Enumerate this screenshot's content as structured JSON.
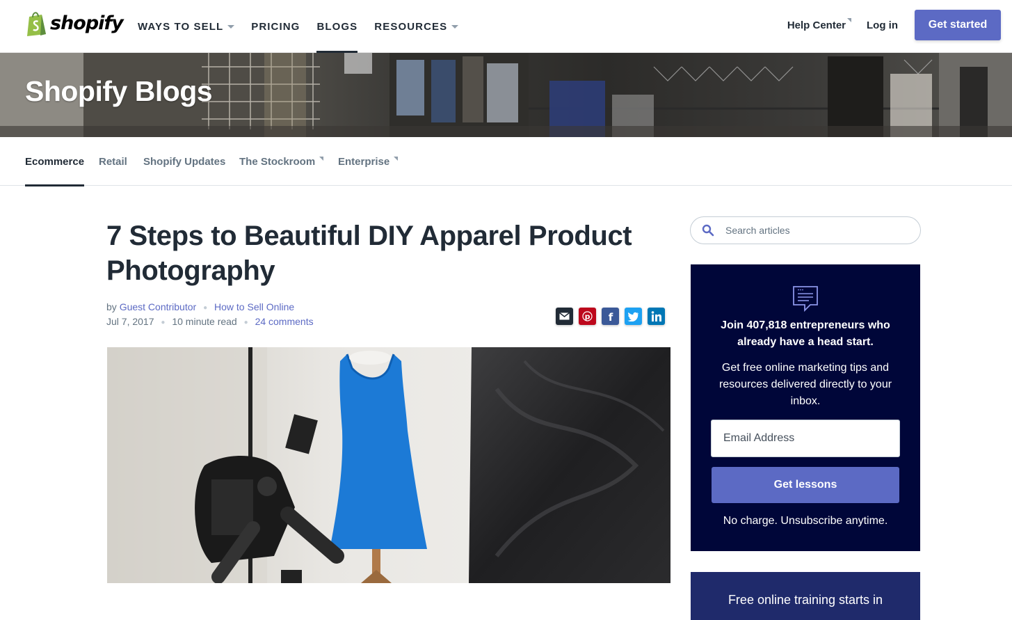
{
  "brand": {
    "name": "shopify",
    "accent": "#5c6ac4",
    "dark": "#212b36",
    "promo_bg": "#000639"
  },
  "topnav": {
    "items": [
      {
        "label": "WAYS TO SELL",
        "dropdown": true
      },
      {
        "label": "PRICING",
        "dropdown": false
      },
      {
        "label": "BLOGS",
        "dropdown": false,
        "active": true
      },
      {
        "label": "RESOURCES",
        "dropdown": true
      }
    ],
    "help_center": "Help Center",
    "login": "Log in",
    "cta": "Get started"
  },
  "hero": {
    "title": "Shopify Blogs"
  },
  "subnav": {
    "items": [
      {
        "label": "Ecommerce",
        "active": true
      },
      {
        "label": "Retail"
      },
      {
        "label": "Shopify Updates"
      },
      {
        "label": "The Stockroom",
        "external": true
      },
      {
        "label": "Enterprise",
        "external": true
      }
    ]
  },
  "article": {
    "title": "7 Steps to Beautiful DIY Apparel Product Photography",
    "by": "by",
    "author": "Guest Contributor",
    "category": "How to Sell Online",
    "date": "Jul 7, 2017",
    "read_time": "10 minute read",
    "comments": "24 comments",
    "share_icons": [
      "email-icon",
      "pinterest-icon",
      "facebook-icon",
      "twitter-icon",
      "linkedin-icon"
    ]
  },
  "sidebar": {
    "search_placeholder": "Search articles",
    "promo": {
      "headline": "Join 407,818 entrepreneurs who already have a head start.",
      "description": "Get free online marketing tips and resources delivered directly to your inbox.",
      "email_placeholder": "Email Address",
      "button": "Get lessons",
      "note": "No charge. Unsubscribe anytime."
    },
    "promo2": {
      "text": "Free online training starts in"
    }
  }
}
